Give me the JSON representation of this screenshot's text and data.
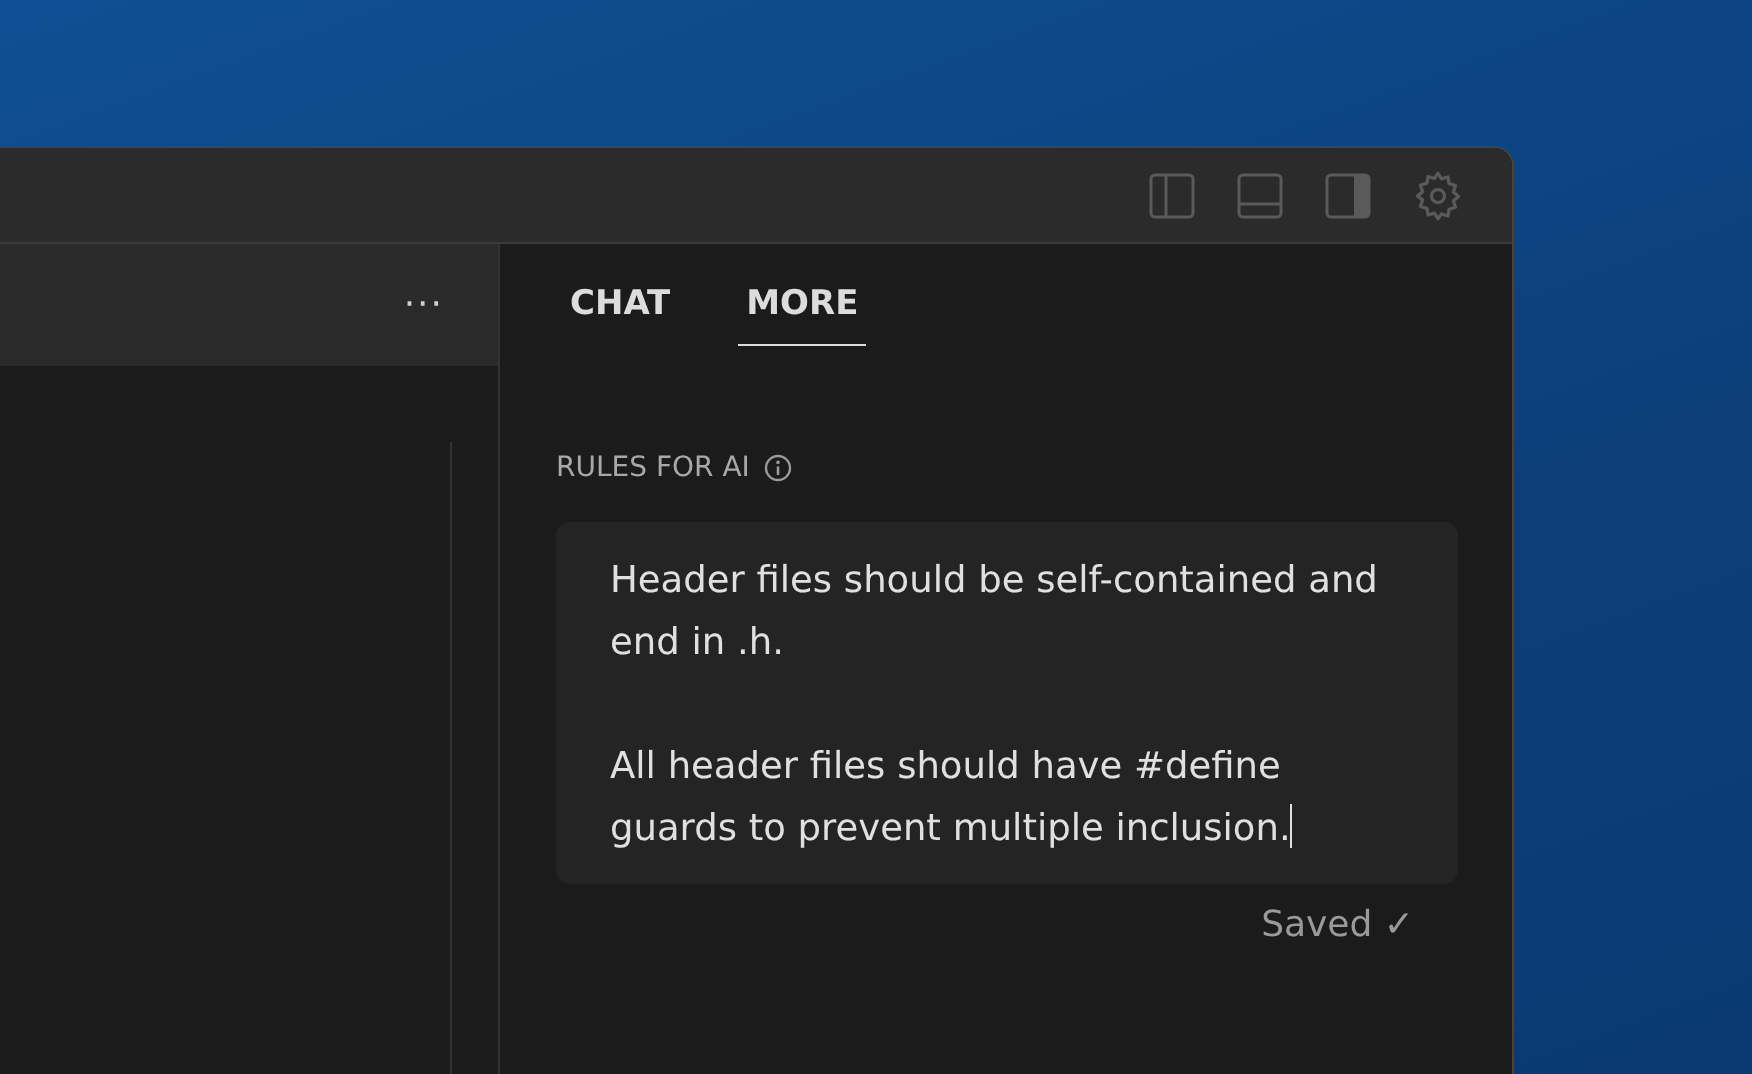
{
  "editor": {
    "more_button": "···"
  },
  "tabs": [
    {
      "label": "CHAT",
      "selected": false
    },
    {
      "label": "MORE",
      "selected": true
    }
  ],
  "rules": {
    "label": "RULES FOR AI",
    "paragraphs": [
      "Header files should be self-contained and end in .h.",
      "All header files should have #define guards to prevent multiple inclusion."
    ],
    "status": "Saved ✓"
  }
}
